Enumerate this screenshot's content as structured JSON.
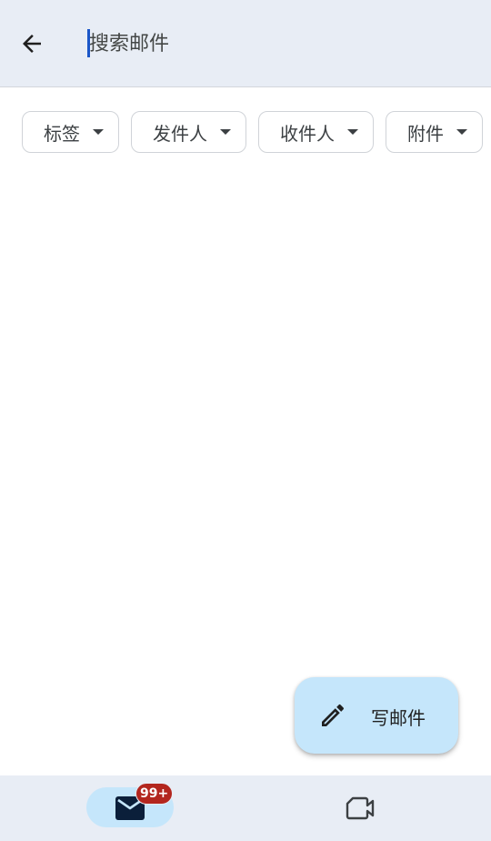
{
  "search": {
    "placeholder": "搜索邮件",
    "value": ""
  },
  "filters": [
    {
      "label": "标签"
    },
    {
      "label": "发件人"
    },
    {
      "label": "收件人"
    },
    {
      "label": "附件"
    }
  ],
  "fab": {
    "label": "写邮件",
    "icon": "pencil-icon"
  },
  "bottom_nav": {
    "mail": {
      "icon": "mail-icon",
      "badge": "99+"
    },
    "meet": {
      "icon": "video-camera-icon"
    }
  },
  "colors": {
    "header_bg": "#e8edf5",
    "accent_container": "#c5e6fb",
    "badge": "#b3261e",
    "caret": "#1a56c8"
  }
}
